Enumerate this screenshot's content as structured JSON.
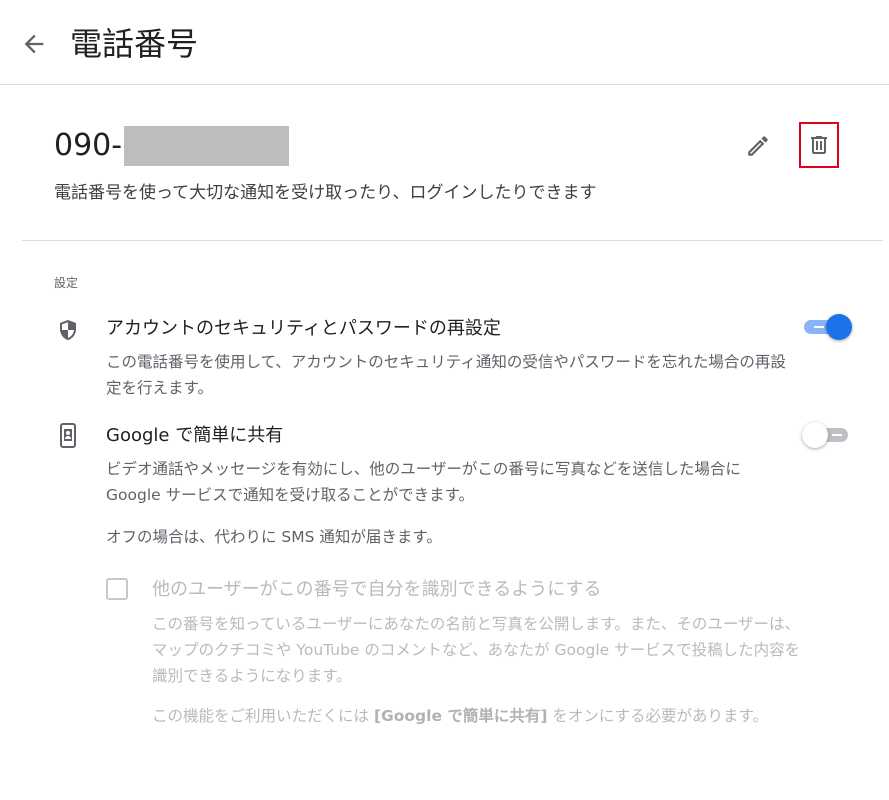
{
  "header": {
    "title": "電話番号",
    "back_icon": "arrow-back-icon"
  },
  "phone": {
    "number_prefix": "090-",
    "description": "電話番号を使って大切な通知を受け取ったり、ログインしたりできます",
    "edit_icon": "pencil-icon",
    "delete_icon": "trash-icon",
    "highlight_color": "#e0001b"
  },
  "settings": {
    "section_label": "設定",
    "items": [
      {
        "icon": "shield-icon",
        "title": "アカウントのセキュリティとパスワードの再設定",
        "description": "この電話番号を使用して、アカウントのセキュリティ通知の受信やパスワードを忘れた場合の再設定を行えます。",
        "enabled": true
      },
      {
        "icon": "phone-share-icon",
        "title": "Google で簡単に共有",
        "description": "ビデオ通話やメッセージを有効にし、他のユーザーがこの番号に写真などを送信した場合に Google サービスで通知を受け取ることができます。",
        "note": "オフの場合は、代わりに SMS 通知が届きます。",
        "enabled": false
      }
    ]
  },
  "discoverability": {
    "checked": false,
    "title": "他のユーザーがこの番号で自分を識別できるようにする",
    "description": "この番号を知っているユーザーにあなたの名前と写真を公開します。また、そのユーザーは、マップのクチコミや YouTube のコメントなど、あなたが Google サービスで投稿した内容を識別できるようになります。",
    "requirement_before": "この機能をご利用いただくには ",
    "requirement_bold": "[Google で簡単に共有]",
    "requirement_after": " をオンにする必要があります。"
  },
  "colors": {
    "accent": "#1a73e8",
    "accent_light": "#8ab4f8",
    "disabled_text": "#b8babd"
  }
}
